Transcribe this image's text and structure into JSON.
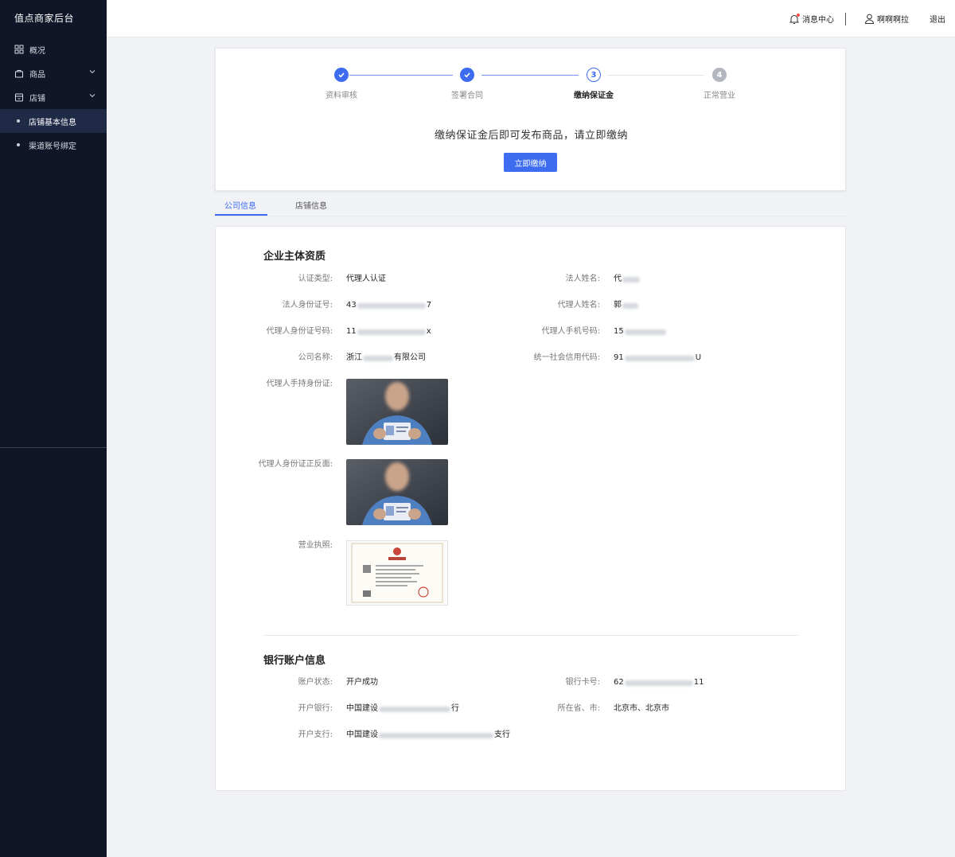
{
  "app": {
    "title": "值点商家后台"
  },
  "sidebar": {
    "items": [
      {
        "label": "概况",
        "icon": "dashboard-icon"
      },
      {
        "label": "商品",
        "icon": "bag-icon"
      },
      {
        "label": "店铺",
        "icon": "store-icon"
      }
    ],
    "sub_items": [
      {
        "label": "店铺基本信息",
        "active": true
      },
      {
        "label": "渠道账号绑定",
        "active": false
      }
    ]
  },
  "header": {
    "messages": "消息中心",
    "username": "啊啊啊拉",
    "logout": "退出"
  },
  "steps": [
    {
      "label": "资料审核",
      "status": "done"
    },
    {
      "label": "签署合同",
      "status": "done"
    },
    {
      "label": "缴纳保证金",
      "status": "current",
      "number": "3"
    },
    {
      "label": "正常营业",
      "status": "todo",
      "number": "4"
    }
  ],
  "notice": {
    "text": "缴纳保证金后即可发布商品，请立即缴纳",
    "button": "立即缴纳"
  },
  "tabs": [
    {
      "label": "公司信息",
      "active": true
    },
    {
      "label": "店铺信息",
      "active": false
    }
  ],
  "company": {
    "title": "企业主体资质",
    "cert_type_label": "认证类型:",
    "cert_type": "代理人认证",
    "legal_name_label": "法人姓名:",
    "legal_name_prefix": "代",
    "legal_id_label": "法人身份证号:",
    "legal_id_prefix": "43",
    "legal_id_suffix": "7",
    "agent_name_label": "代理人姓名:",
    "agent_name_prefix": "郭",
    "agent_id_label": "代理人身份证号码:",
    "agent_id_prefix": "11",
    "agent_id_suffix": "x",
    "agent_phone_label": "代理人手机号码:",
    "agent_phone_prefix": "15",
    "company_name_label": "公司名称:",
    "company_name_prefix": "浙江",
    "company_name_suffix": "有限公司",
    "credit_code_label": "统一社会信用代码:",
    "credit_code_prefix": "91",
    "credit_code_suffix": "U",
    "hand_id_label": "代理人手持身份证:",
    "id_both_label": "代理人身份证正反面:",
    "license_label": "营业执照:"
  },
  "bank": {
    "title": "银行账户信息",
    "status_label": "账户状态:",
    "status": "开户成功",
    "card_label": "银行卡号:",
    "card_prefix": "62",
    "card_suffix": "11",
    "bank_label": "开户银行:",
    "bank_prefix": "中国建设",
    "bank_suffix": "行",
    "region_label": "所在省、市:",
    "region": "北京市、北京市",
    "branch_label": "开户支行:",
    "branch_prefix": "中国建设",
    "branch_suffix": "支行"
  },
  "colors": {
    "sidebar_bg": "#101627",
    "accent": "#3d6cf0",
    "page_bg": "#f0f2f5"
  }
}
